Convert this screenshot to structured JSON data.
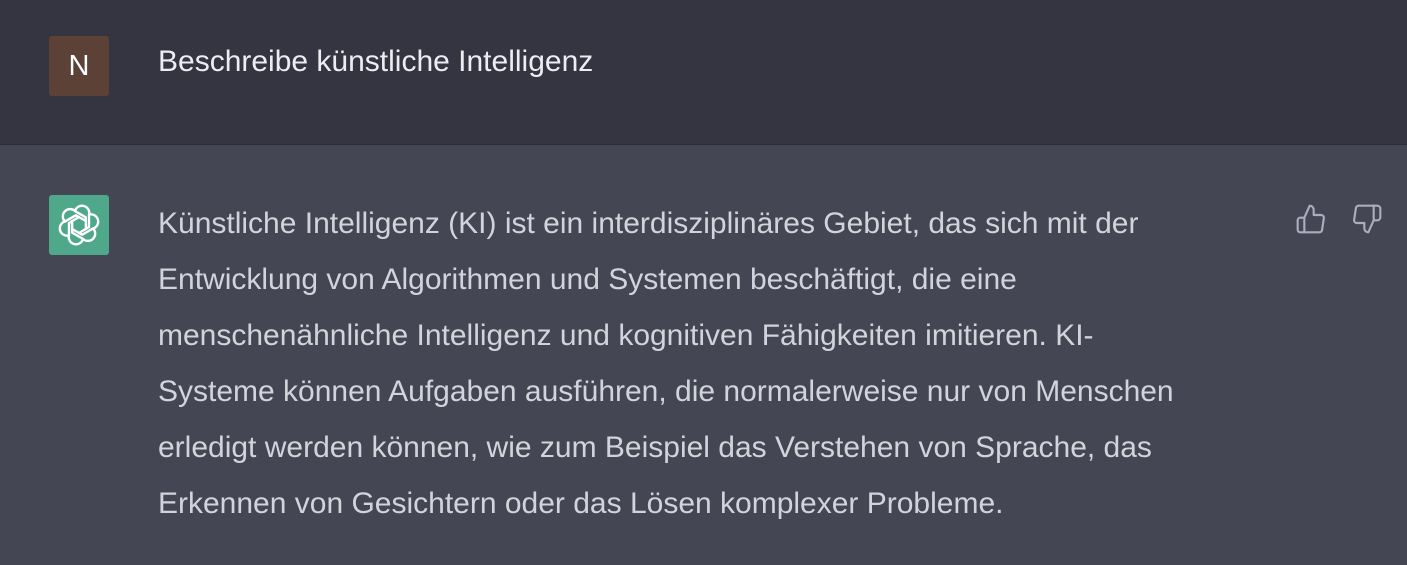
{
  "user_message": {
    "avatar_initial": "N",
    "avatar_color": "#5b4136",
    "text": "Beschreibe künstliche Intelligenz"
  },
  "assistant_message": {
    "avatar_icon": "openai-logo-icon",
    "avatar_color": "#4ea889",
    "lines": [
      "Künstliche Intelligenz (KI) ist ein interdisziplinäres Gebiet, das sich mit der",
      "Entwicklung von Algorithmen und Systemen beschäftigt, die eine",
      "menschenähnliche Intelligenz und kognitiven Fähigkeiten imitieren. KI-",
      "Systeme können Aufgaben ausführen, die normalerweise nur von Menschen",
      "erledigt werden können, wie zum Beispiel das Verstehen von Sprache, das",
      "Erkennen von Gesichtern oder das Lösen komplexer Probleme."
    ],
    "feedback_icons": [
      "thumbs-up-icon",
      "thumbs-down-icon"
    ]
  },
  "colors": {
    "user_bg": "#343541",
    "assistant_bg": "#444654",
    "text": "#d1d5db"
  }
}
